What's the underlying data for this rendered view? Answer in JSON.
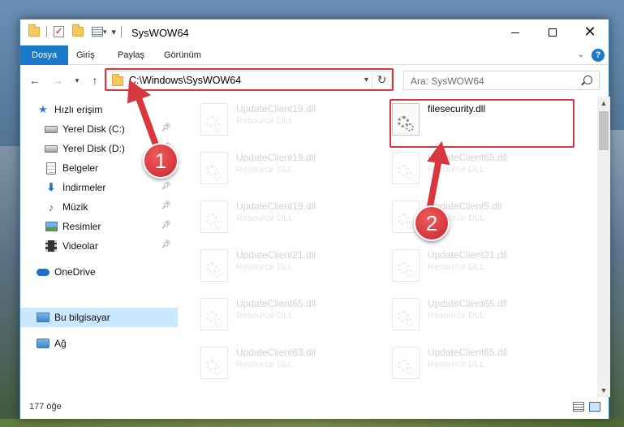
{
  "window": {
    "title": "SysWOW64",
    "minimize_label": "",
    "maximize_label": "",
    "close_label": "✕"
  },
  "ribbon": {
    "tabs": [
      "Dosya",
      "Giriş",
      "Paylaş",
      "Görünüm"
    ],
    "active_tab": "Dosya",
    "help": "?"
  },
  "navigation": {
    "address": "C:\\Windows\\SysWOW64",
    "search_placeholder": "Ara: SysWOW64"
  },
  "sidebar": {
    "items": [
      {
        "label": "Hızlı erişim",
        "icon": "star-icon",
        "pinned": false
      },
      {
        "label": "Yerel Disk (C:)",
        "icon": "drive-icon",
        "pinned": true
      },
      {
        "label": "Yerel Disk (D:)",
        "icon": "drive-icon",
        "pinned": true
      },
      {
        "label": "Belgeler",
        "icon": "document-icon",
        "pinned": true
      },
      {
        "label": "İndirmeler",
        "icon": "download-icon",
        "pinned": true
      },
      {
        "label": "Müzik",
        "icon": "music-icon",
        "pinned": true
      },
      {
        "label": "Resimler",
        "icon": "pictures-icon",
        "pinned": true
      },
      {
        "label": "Videolar",
        "icon": "video-icon",
        "pinned": true
      },
      {
        "label": "OneDrive",
        "icon": "onedrive-icon",
        "pinned": false
      },
      {
        "label": "Bu bilgisayar",
        "icon": "computer-icon",
        "pinned": false,
        "selected": true
      },
      {
        "label": "Ağ",
        "icon": "network-icon",
        "pinned": false
      }
    ]
  },
  "files": [
    {
      "name": "UpdateClient19.dll",
      "type": "Resource DLL",
      "faded": true
    },
    {
      "name": "filesecurity.dll",
      "type": "",
      "faded": false,
      "highlighted": true
    },
    {
      "name": "UpdateClient19.dll",
      "type": "Resource DLL",
      "faded": true
    },
    {
      "name": "UpdateClient65.dll",
      "type": "Resource DLL",
      "faded": true
    },
    {
      "name": "UpdateClient19.dll",
      "type": "Resource DLL",
      "faded": true
    },
    {
      "name": "UpdateClient5.dll",
      "type": "Resource DLL",
      "faded": true
    },
    {
      "name": "UpdateClient21.dll",
      "type": "Resource DLL",
      "faded": true
    },
    {
      "name": "UpdateClient21.dll",
      "type": "Resource DLL",
      "faded": true
    },
    {
      "name": "UpdateClient65.dll",
      "type": "Resource DLL",
      "faded": true
    },
    {
      "name": "UpdateClient65.dll",
      "type": "Resource DLL",
      "faded": true
    },
    {
      "name": "UpdateClient63.dll",
      "type": "Resource DLL",
      "faded": true
    },
    {
      "name": "UpdateClient65.dll",
      "type": "Resource DLL",
      "faded": true
    }
  ],
  "status": {
    "item_count": "177 öğe"
  },
  "callouts": [
    "1",
    "2"
  ],
  "colors": {
    "accent": "#1979ca",
    "highlight": "#d9363e",
    "selection": "#cce8ff"
  }
}
